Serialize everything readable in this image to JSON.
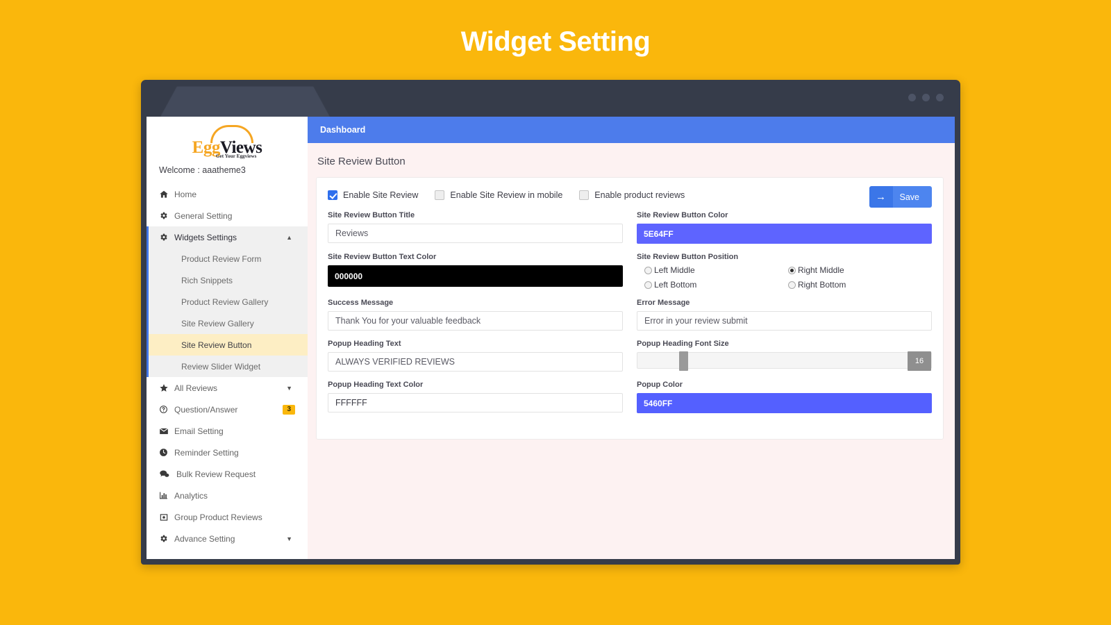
{
  "page": {
    "title": "Widget Setting",
    "accent_bg": "#fab70c"
  },
  "browser": {
    "tab_label": ""
  },
  "sidebar": {
    "logo": {
      "word_primary": "Egg",
      "word_secondary": "Views",
      "tagline": "Get Your Eggviews"
    },
    "welcome": "Welcome : aaatheme3",
    "items": [
      {
        "label": "Home",
        "icon": "home-icon"
      },
      {
        "label": "General Setting",
        "icon": "gear-icon"
      },
      {
        "label": "Widgets Settings",
        "icon": "gear-icon",
        "caret": "▲"
      },
      {
        "label": "All Reviews",
        "icon": "star-icon",
        "caret": "▼"
      },
      {
        "label": "Question/Answer",
        "icon": "question-circle-icon",
        "badge": "3"
      },
      {
        "label": "Email Setting",
        "icon": "envelope-icon"
      },
      {
        "label": "Reminder Setting",
        "icon": "clock-icon"
      },
      {
        "label": "Bulk Review Request",
        "icon": "chat-bubbles-icon"
      },
      {
        "label": "Analytics",
        "icon": "bar-chart-icon"
      },
      {
        "label": "Group Product Reviews",
        "icon": "frame-icon"
      },
      {
        "label": "Advance Setting",
        "icon": "gear-icon",
        "caret": "▼"
      }
    ],
    "subitems": [
      "Product Review Form",
      "Rich Snippets",
      "Product Review Gallery",
      "Site Review Gallery",
      "Site Review Button",
      "Review Slider Widget"
    ],
    "active_subitem": "Site Review Button"
  },
  "topbar": {
    "breadcrumb": "Dashboard"
  },
  "main": {
    "heading": "Site Review Button",
    "save_label": "Save",
    "checkboxes": [
      {
        "label": "Enable Site Review",
        "checked": true
      },
      {
        "label": "Enable Site Review in mobile",
        "checked": false
      },
      {
        "label": "Enable product reviews",
        "checked": false
      }
    ],
    "fields": {
      "button_title_label": "Site Review Button Title",
      "button_title_value": "Reviews",
      "button_color_label": "Site Review Button Color",
      "button_color_value": "5E64FF",
      "button_text_color_label": "Site Review Button Text Color",
      "button_text_color_value": "000000",
      "button_position_label": "Site Review Button Position",
      "success_message_label": "Success Message",
      "success_message_value": "Thank You for your valuable feedback",
      "error_message_label": "Error Message",
      "error_message_value": "Error in your review submit",
      "popup_heading_text_label": "Popup Heading Text",
      "popup_heading_text_value": "ALWAYS VERIFIED REVIEWS",
      "popup_heading_font_size_label": "Popup Heading Font Size",
      "popup_heading_font_size_value": "16",
      "popup_heading_text_color_label": "Popup Heading Text Color",
      "popup_heading_text_color_value": "FFFFFF",
      "popup_color_label": "Popup Color",
      "popup_color_value": "5460FF"
    },
    "positions": [
      {
        "label": "Left Middle",
        "selected": false
      },
      {
        "label": "Right Middle",
        "selected": true
      },
      {
        "label": "Left Bottom",
        "selected": false
      },
      {
        "label": "Right Bottom",
        "selected": false
      }
    ]
  }
}
